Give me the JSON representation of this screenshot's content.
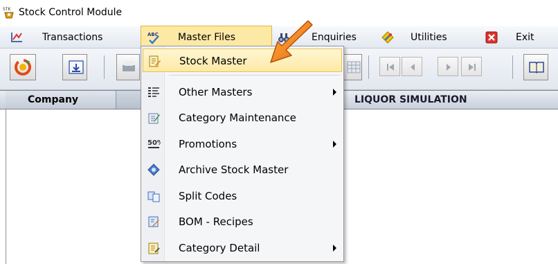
{
  "window": {
    "title": "Stock Control Module"
  },
  "menubar": {
    "transactions": "Transactions",
    "master_files": "Master Files",
    "enquiries": "Enquiries",
    "utilities": "Utilities",
    "exit": "Exit"
  },
  "header": {
    "company_label": "Company",
    "company_name": "LIQUOR SIMULATION"
  },
  "dropdown": {
    "items": [
      {
        "label": "Stock Master",
        "icon": "stock-master-icon",
        "submenu": false,
        "highlighted": true
      },
      {
        "label": "Other Masters",
        "icon": "list-icon",
        "submenu": true
      },
      {
        "label": "Category Maintenance",
        "icon": "edit-icon",
        "submenu": false
      },
      {
        "label": "Promotions",
        "icon": "percent-icon",
        "submenu": true
      },
      {
        "label": "Archive Stock Master",
        "icon": "archive-icon",
        "submenu": false
      },
      {
        "label": "Split Codes",
        "icon": "split-icon",
        "submenu": false
      },
      {
        "label": "BOM - Recipes",
        "icon": "recipe-icon",
        "submenu": false
      },
      {
        "label": "Category Detail",
        "icon": "category-detail-icon",
        "submenu": true
      }
    ]
  },
  "colors": {
    "menu_highlight": "#fde9a6",
    "menu_highlight_border": "#e2b43e",
    "annotation_arrow": "#f07a1a"
  }
}
